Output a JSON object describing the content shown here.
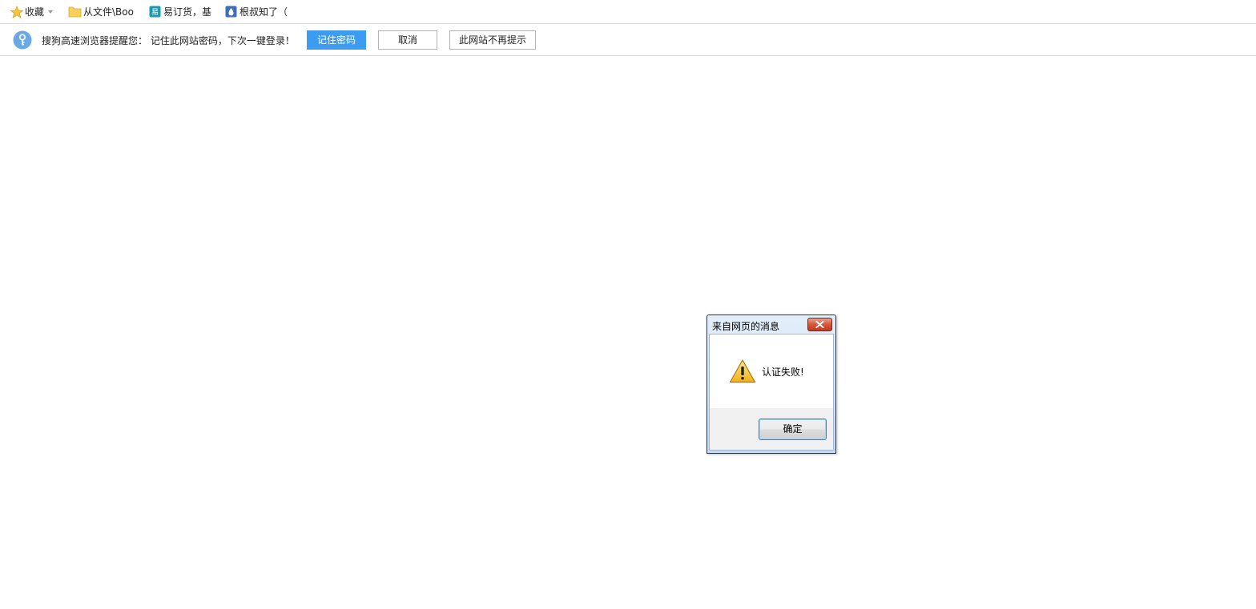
{
  "bookmarks": {
    "favorites_label": "收藏",
    "items": [
      {
        "label": "从文件\\Boo",
        "icon": "folder-icon"
      },
      {
        "label": "易订货，基",
        "icon": "app-icon"
      },
      {
        "label": "根叔知了（",
        "icon": "drop-icon"
      }
    ]
  },
  "password_prompt": {
    "message": "搜狗高速浏览器提醒您： 记住此网站密码，下次一键登录！",
    "remember_label": "记住密码",
    "cancel_label": "取消",
    "never_label": "此网站不再提示",
    "accent_color": "#3b9cf1"
  },
  "alert_dialog": {
    "title": "来自网页的消息",
    "message": "认证失败!",
    "ok_label": "确定",
    "icon": "warning-icon"
  }
}
